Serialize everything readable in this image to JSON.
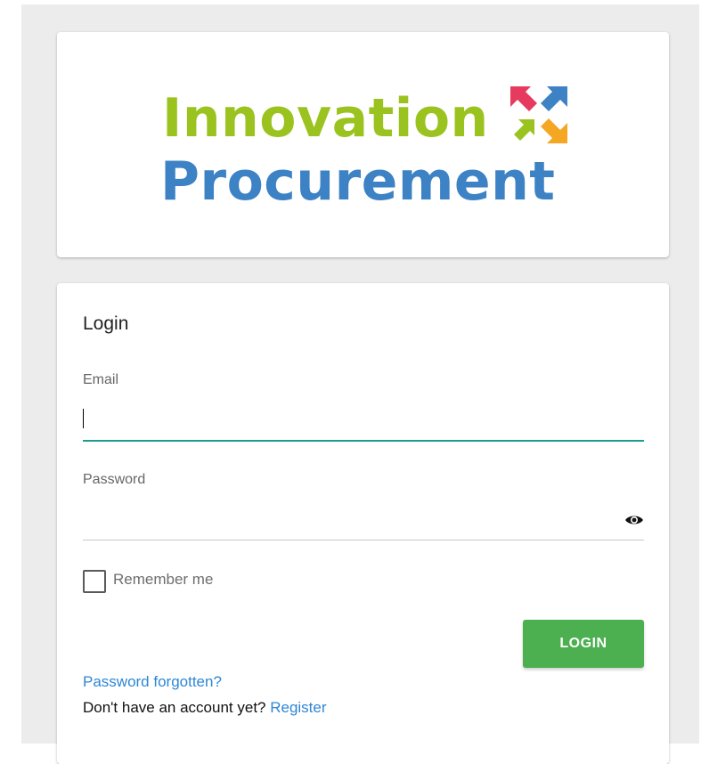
{
  "logo": {
    "line1": "Innovation",
    "line2": "Procurement",
    "line1_color": "#9bc31f",
    "line2_color": "#3c82c4",
    "arrow_colors": [
      "#e63a5e",
      "#3c82c4",
      "#9bc31f",
      "#f5a623"
    ]
  },
  "login": {
    "title": "Login",
    "email": {
      "label": "Email",
      "value": "",
      "placeholder": ""
    },
    "password": {
      "label": "Password",
      "value": "",
      "placeholder": "",
      "toggle_icon": "eye-icon"
    },
    "remember_me": {
      "label": "Remember me",
      "checked": false
    },
    "submit_label": "LOGIN",
    "forgot_password_label": "Password forgotten?",
    "register_prompt": "Don't have an account yet? ",
    "register_label": "Register"
  },
  "colors": {
    "background": "#ececec",
    "card": "#ffffff",
    "accent_underline": "#1d9b8c",
    "button": "#4caf50",
    "link": "#2f86d6"
  }
}
